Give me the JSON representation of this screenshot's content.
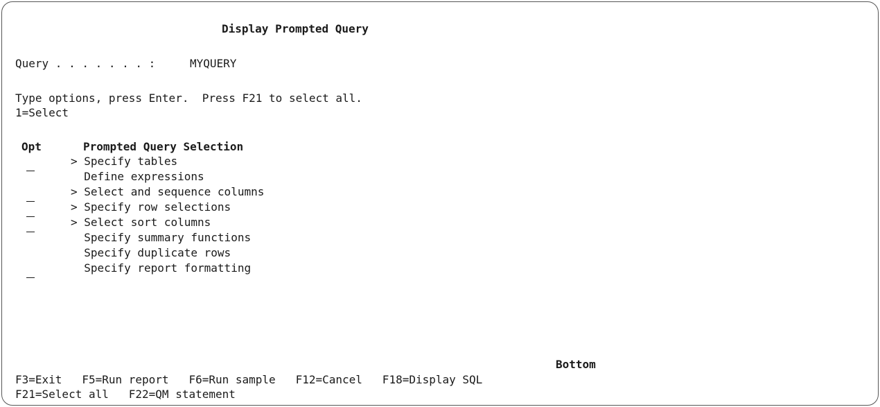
{
  "screen": {
    "title": "Display Prompted Query",
    "query_label": "Query . . . . . . . :",
    "query_value": "MYQUERY",
    "instruction": "Type options, press Enter.  Press F21 to select all.",
    "options_legend": "1=Select",
    "col_opt": "Opt",
    "col_selection": "Prompted Query Selection",
    "items": [
      {
        "label": "> Specify tables",
        "has_input": true
      },
      {
        "label": "  Define expressions",
        "has_input": false
      },
      {
        "label": "> Select and sequence columns",
        "has_input": true
      },
      {
        "label": "> Specify row selections",
        "has_input": true
      },
      {
        "label": "> Select sort columns",
        "has_input": true
      },
      {
        "label": "  Specify summary functions",
        "has_input": false
      },
      {
        "label": "  Specify duplicate rows",
        "has_input": false
      },
      {
        "label": "  Specify report formatting",
        "has_input": true
      }
    ],
    "bottom_indicator": "Bottom",
    "function_keys_line1": "F3=Exit   F5=Run report   F6=Run sample   F12=Cancel   F18=Display SQL",
    "function_keys_line2": "F21=Select all   F22=QM statement"
  }
}
